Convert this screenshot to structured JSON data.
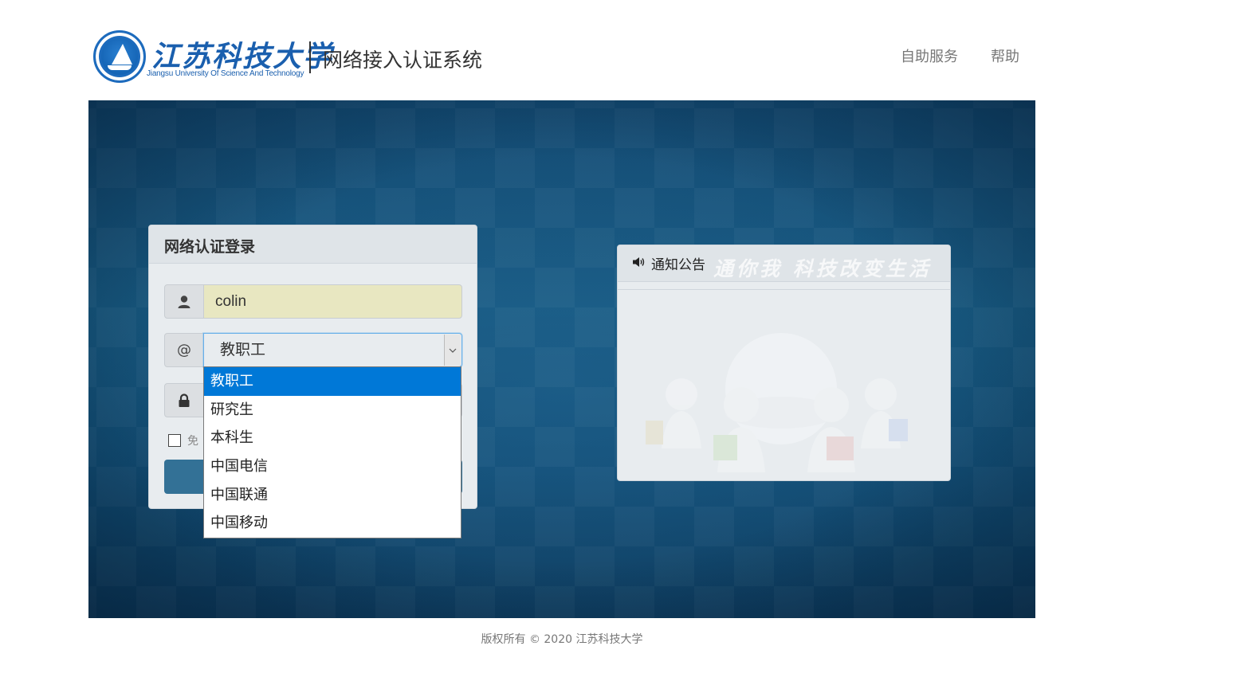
{
  "header": {
    "logo_name": "江苏科技大学",
    "logo_subtitle": "Jiangsu University Of Science And Technology",
    "system_title": "网络接入认证系统",
    "nav": [
      {
        "label": "自助服务"
      },
      {
        "label": "帮助"
      }
    ]
  },
  "login": {
    "heading": "网络认证登录",
    "username_value": "colin",
    "domain_prefix": "@",
    "domain_selected": "教职工",
    "remember_label": "免",
    "domain_options": [
      {
        "label": "教职工",
        "selected": true
      },
      {
        "label": "研究生",
        "selected": false
      },
      {
        "label": "本科生",
        "selected": false
      },
      {
        "label": "中国电信",
        "selected": false
      },
      {
        "label": "中国联通",
        "selected": false
      },
      {
        "label": "中国移动",
        "selected": false
      }
    ]
  },
  "notice": {
    "heading": "通知公告",
    "watermark": "通你我  科技改变生活"
  },
  "footer": {
    "copyright": "版权所有 © 2020 江苏科技大学"
  },
  "colors": {
    "brand_blue": "#1a5fae",
    "banner_blue": "#134a72",
    "dropdown_highlight": "#0078d7",
    "login_button": "#337196",
    "autofill_yellow": "#e8e7c1"
  }
}
